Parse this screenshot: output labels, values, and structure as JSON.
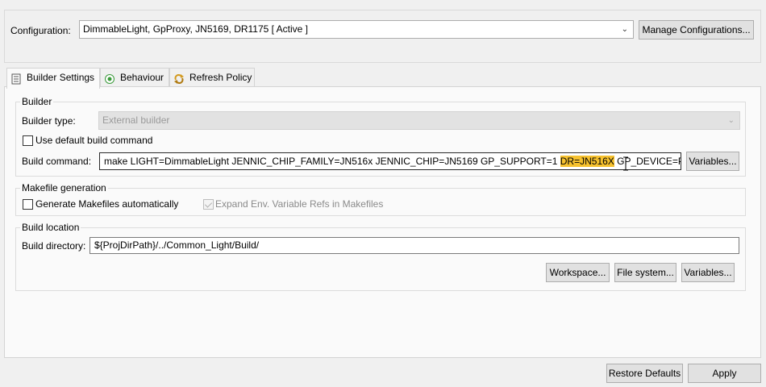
{
  "configuration": {
    "label": "Configuration:",
    "value": "DimmableLight, GpProxy, JN5169, DR1175  [ Active ]",
    "manage_button": "Manage Configurations..."
  },
  "tabs": [
    {
      "label": "Builder Settings",
      "icon": "builder-settings-icon",
      "active": true
    },
    {
      "label": "Behaviour",
      "icon": "radio-behaviour-icon",
      "active": false
    },
    {
      "label": "Refresh Policy",
      "icon": "refresh-policy-icon",
      "active": false
    }
  ],
  "builder": {
    "group_title": "Builder",
    "type_label": "Builder type:",
    "type_value": "External builder",
    "use_default_label": "Use default build command",
    "use_default_checked": false,
    "command_label": "Build command:",
    "command_before": "make LIGHT=DimmableLight JENNIC_CHIP_FAMILY=JN516x JENNIC_CHIP=JN5169 GP_SUPPORT=1 ",
    "command_highlight": "DR=JN516X",
    "command_after": " GP_DEVICE=PROXY_BA",
    "variables_button": "Variables..."
  },
  "makefile": {
    "group_title": "Makefile generation",
    "generate_label": "Generate Makefiles automatically",
    "generate_checked": false,
    "expand_label": "Expand Env. Variable Refs in Makefiles",
    "expand_checked": true
  },
  "location": {
    "group_title": "Build location",
    "directory_label": "Build directory:",
    "directory_value": "${ProjDirPath}/../Common_Light/Build/",
    "workspace_button": "Workspace...",
    "filesystem_button": "File system...",
    "variables_button": "Variables..."
  },
  "footer": {
    "restore_defaults": "Restore Defaults",
    "apply": "Apply"
  },
  "colors": {
    "highlight": "#f6c12e",
    "panel": "#fafafa",
    "background": "#f0f0f0"
  }
}
